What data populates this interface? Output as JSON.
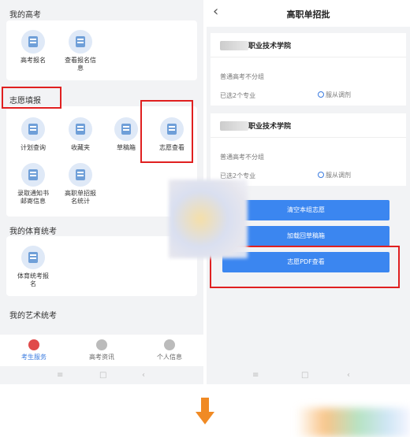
{
  "left": {
    "section_gaokao": "我的高考",
    "gaokao_items": [
      "高考报名",
      "查看报名信\n息"
    ],
    "section_zhiyuan": "志愿填报",
    "zhiyuan_items": [
      "计划查询",
      "收藏夹",
      "草稿箱",
      "志愿查看",
      "录取通知书\n邮寄信息",
      "高职单招报\n名统计"
    ],
    "section_tiyu": "我的体育统考",
    "tiyu_items": [
      "体育统考报\n名"
    ],
    "section_yishu": "我的艺术统考",
    "tabs": [
      "考生服务",
      "高考资讯",
      "个人信息"
    ]
  },
  "right": {
    "title": "高职单招批",
    "schools": [
      {
        "name": "职业技术学院",
        "group": "普通高考不分组",
        "selected": "已选2个专业",
        "adjust": "服从调剂"
      },
      {
        "name": "职业技术学院",
        "group": "普通高考不分组",
        "selected": "已选2个专业",
        "adjust": "服从调剂"
      }
    ],
    "buttons": [
      "清空本组志愿",
      "加载回草稿箱",
      "志愿PDF查看"
    ]
  },
  "system_nav": [
    "≡",
    "□",
    "‹"
  ],
  "colors": {
    "accent": "#3b86f0",
    "highlight": "#e02020",
    "arrow": "#f08a24"
  }
}
